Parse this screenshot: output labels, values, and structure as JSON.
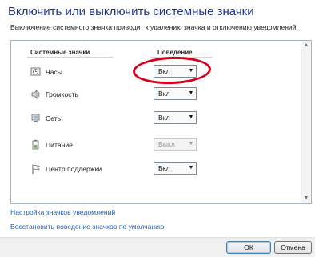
{
  "window": {
    "title": "Включить или выключить системные значки",
    "description": "Выключение системного значка приводит к удалению значка и отключению уведомлений."
  },
  "table": {
    "header_name": "Системные значки",
    "header_behavior": "Поведение",
    "rows": [
      {
        "label": "Часы",
        "icon": "clock-icon",
        "value": "Вкл",
        "enabled": true
      },
      {
        "label": "Громкость",
        "icon": "speaker-icon",
        "value": "Вкл",
        "enabled": true
      },
      {
        "label": "Сеть",
        "icon": "network-icon",
        "value": "Вкл",
        "enabled": true
      },
      {
        "label": "Питание",
        "icon": "battery-icon",
        "value": "Выкл",
        "enabled": false
      },
      {
        "label": "Центр поддержки",
        "icon": "flag-icon",
        "value": "Вкл",
        "enabled": true
      }
    ]
  },
  "links": {
    "customize": "Настройка значков уведомлений",
    "restore": "Восстановить поведение значков по умолчанию"
  },
  "buttons": {
    "ok": "ОК",
    "cancel": "Отмена"
  },
  "colors": {
    "title": "#1e3287",
    "link": "#1f5fb6",
    "highlight": "#d6001c"
  }
}
